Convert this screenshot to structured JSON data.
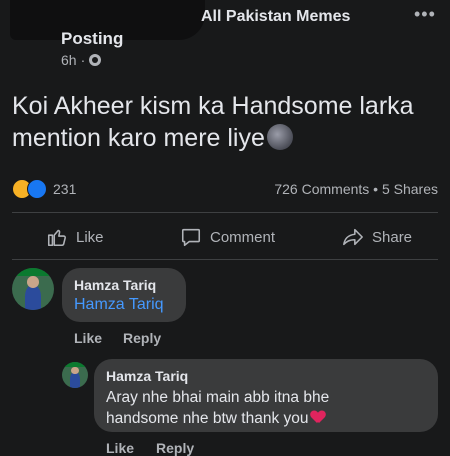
{
  "post": {
    "group_name": "All Pakistan Memes",
    "poster_name": "Posting",
    "time": "6h",
    "text": "Koi Akheer kism ka Handsome larka mention karo mere liye",
    "reaction_count": "231",
    "stats": "726 Comments • 5 Shares",
    "more_icon": "•••"
  },
  "actions": {
    "like": "Like",
    "comment": "Comment",
    "share": "Share"
  },
  "comments": [
    {
      "name": "Hamza Tariq",
      "mention": "Hamza Tariq",
      "like": "Like",
      "reply": "Reply"
    },
    {
      "name": "Hamza Tariq",
      "text_line1": "Aray nhe bhai main abb itna bhe",
      "text_line2": "handsome nhe btw thank you",
      "like": "Like",
      "reply": "Reply"
    }
  ],
  "colors": {
    "background": "#18191a",
    "bubble": "#3a3b3c",
    "link": "#4599ff",
    "secondary_text": "#b0b3b8"
  }
}
